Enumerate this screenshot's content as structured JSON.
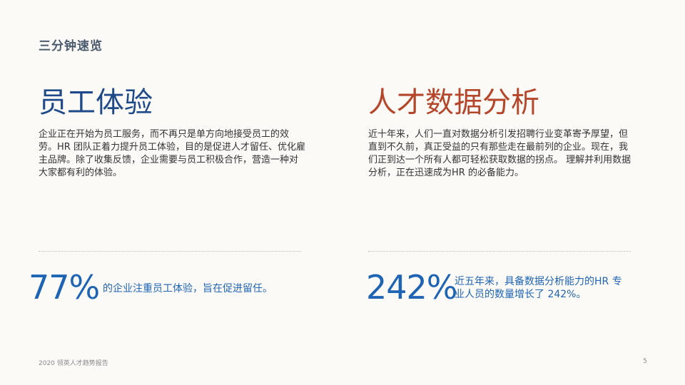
{
  "kicker": "三分钟速览",
  "left": {
    "heading": "员工体验",
    "body": "企业正在开始为员工服务，而不再只是单方向地接受员工的效劳。HR 团队正着力提升员工体验，目的是促进人才留任、优化雇主品牌。除了收集反馈，企业需要与员工积极合作，营造一种对大家都有利的体验。",
    "stat_value": "77%",
    "stat_text": "的企业注重员工体验，旨在促进留任。"
  },
  "right": {
    "heading": "人才数据分析",
    "body": "近十年来，人们一直对数据分析引发招聘行业变革寄予厚望，但直到不久前，真正受益的只有那些走在最前列的企业。现在，我们正到达一个所有人都可轻松获取数据的拐点。 理解并利用数据分析，正在迅速成为HR 的必备能力。",
    "stat_value": "242%",
    "stat_text": "近五年来，具备数据分析能力的HR 专业人员的数量增长了 242%。"
  },
  "footer": {
    "source": "2020 领英人才趋势报告",
    "page": "5"
  },
  "colors": {
    "background": "#fcfaf7",
    "left_heading": "#1f4a8a",
    "right_heading": "#b5462a",
    "stat_blue": "#1e64b4"
  }
}
